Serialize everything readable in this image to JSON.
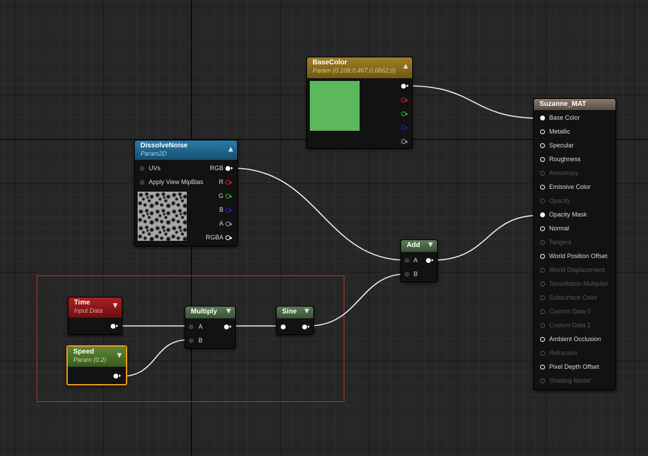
{
  "colors": {
    "base_color_swatch": "#5cb85a",
    "comment_border": "#c62a2a",
    "basecolor_header": "#8a6c1c",
    "dissolve_header": "#1c5f86",
    "time_header": "#8c1a1a",
    "speed_header": "#4a6e2a",
    "math_header": "#4a6446",
    "output_header": "#6a5a50",
    "speed_selected": "#e89a1a"
  },
  "nodes": {
    "basecolor": {
      "title": "BaseColor",
      "subtitle": "Param (0.108,0.467,0.0862,0)"
    },
    "dissolve": {
      "title": "DissolveNoise",
      "subtitle": "Param2D",
      "inputs": [
        "UVs",
        "Apply View MipBias"
      ],
      "outputs": [
        "RGB",
        "R",
        "G",
        "B",
        "A",
        "RGBA"
      ]
    },
    "time": {
      "title": "Time",
      "subtitle": "Input Data"
    },
    "speed": {
      "title": "Speed",
      "subtitle": "Param (0.2)"
    },
    "multiply": {
      "title": "Multiply",
      "inputs": [
        "A",
        "B"
      ]
    },
    "sine": {
      "title": "Sine"
    },
    "add": {
      "title": "Add",
      "inputs": [
        "A",
        "B"
      ]
    },
    "output": {
      "title": "Suzanne_MAT",
      "pins": [
        {
          "label": "Base Color",
          "enabled": true,
          "connected": true
        },
        {
          "label": "Metallic",
          "enabled": true,
          "connected": false
        },
        {
          "label": "Specular",
          "enabled": true,
          "connected": false
        },
        {
          "label": "Roughness",
          "enabled": true,
          "connected": false
        },
        {
          "label": "Anisotropy",
          "enabled": false,
          "connected": false
        },
        {
          "label": "Emissive Color",
          "enabled": true,
          "connected": false
        },
        {
          "label": "Opacity",
          "enabled": false,
          "connected": false
        },
        {
          "label": "Opacity Mask",
          "enabled": true,
          "connected": true
        },
        {
          "label": "Normal",
          "enabled": true,
          "connected": false
        },
        {
          "label": "Tangent",
          "enabled": false,
          "connected": false
        },
        {
          "label": "World Position Offset",
          "enabled": true,
          "connected": false
        },
        {
          "label": "World Displacement",
          "enabled": false,
          "connected": false
        },
        {
          "label": "Tessellation Multiplier",
          "enabled": false,
          "connected": false
        },
        {
          "label": "Subsurface Color",
          "enabled": false,
          "connected": false
        },
        {
          "label": "Custom Data 0",
          "enabled": false,
          "connected": false
        },
        {
          "label": "Custom Data 1",
          "enabled": false,
          "connected": false
        },
        {
          "label": "Ambient Occlusion",
          "enabled": true,
          "connected": false
        },
        {
          "label": "Refraction",
          "enabled": false,
          "connected": false
        },
        {
          "label": "Pixel Depth Offset",
          "enabled": true,
          "connected": false
        },
        {
          "label": "Shading Model",
          "enabled": false,
          "connected": false
        }
      ]
    }
  }
}
